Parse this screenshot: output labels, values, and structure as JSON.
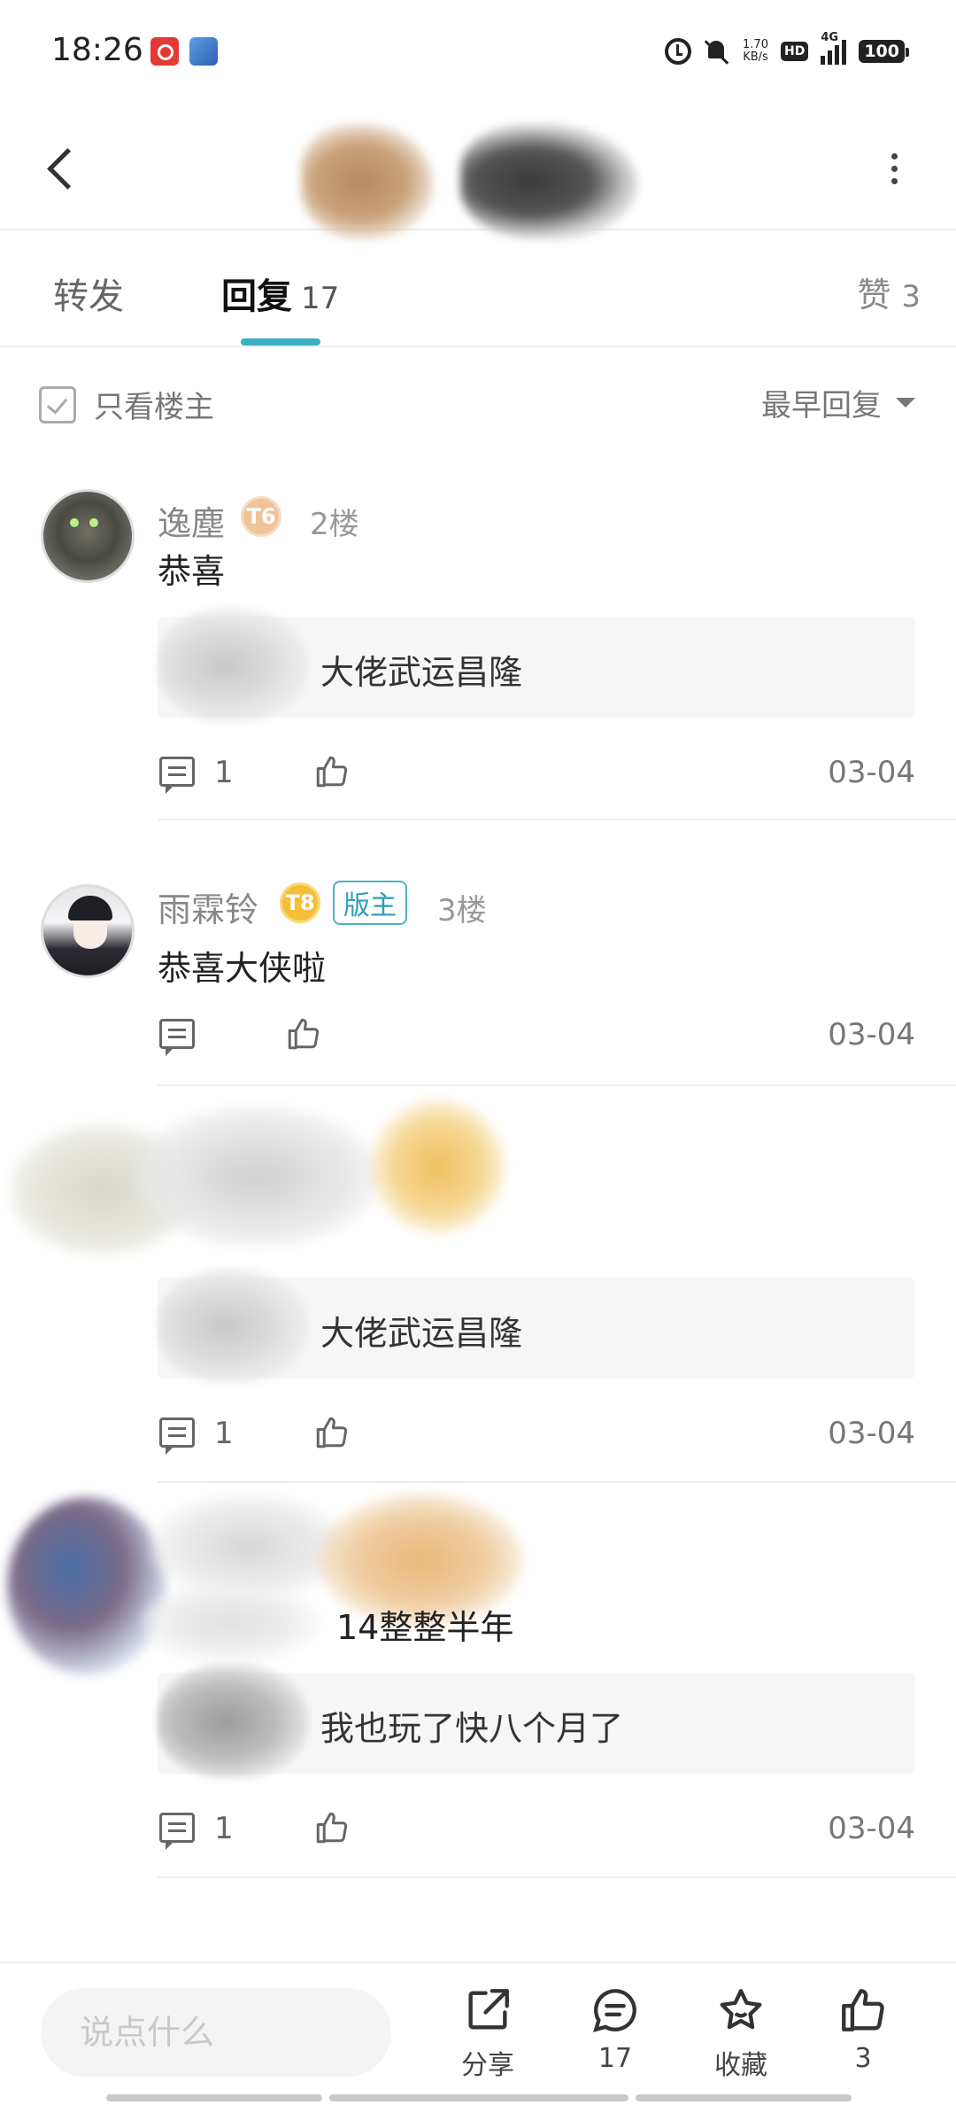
{
  "status_bar": {
    "time": "18:26",
    "net_speed_value": "1.70",
    "net_speed_unit": "KB/s",
    "hd": "HD",
    "network": "4G",
    "battery": "100"
  },
  "tabs": {
    "forward": "转发",
    "reply": "回复",
    "reply_count": "17",
    "like": "赞",
    "like_count": "3"
  },
  "filter": {
    "only_op": "只看楼主",
    "sort": "最早回复"
  },
  "posts": [
    {
      "username": "逸塵",
      "level": "T6",
      "floor": "2楼",
      "content": "恭喜",
      "quote": "大佬武运昌隆",
      "comment_count": "1",
      "date": "03-04"
    },
    {
      "username": "雨霖铃",
      "level": "T8",
      "mod_badge": "版主",
      "floor": "3楼",
      "content": "恭喜大侠啦",
      "date": "03-04"
    },
    {
      "quote": "大佬武运昌隆",
      "comment_count": "1",
      "date": "03-04"
    },
    {
      "content_fragment": "14整整半年",
      "quote": "我也玩了快八个月了",
      "comment_count": "1",
      "date": "03-04"
    }
  ],
  "bottom_bar": {
    "input_placeholder": "说点什么",
    "share": "分享",
    "comment_count": "17",
    "favorite": "收藏",
    "like_count": "3"
  },
  "colors": {
    "accent": "#3ab0c3",
    "mod_badge": "#2e9eb4",
    "level_t6": "#f0c49a",
    "level_t8": "#f4bf36"
  }
}
